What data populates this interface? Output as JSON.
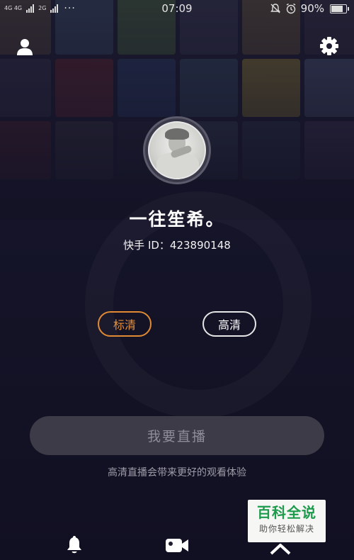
{
  "status_bar": {
    "network_primary": "4G 4G",
    "network_secondary": "2G",
    "more": "···",
    "time": "07:09",
    "battery_percent": "90%",
    "battery_level": 0.9
  },
  "header": {
    "profile_icon": "user-icon",
    "settings_icon": "gear-icon"
  },
  "profile": {
    "name": "一往笙希。",
    "id_text": "快手 ID：423890148"
  },
  "quality": {
    "options": [
      "标清",
      "高清"
    ],
    "selected": "标清"
  },
  "live": {
    "button_label": "我要直播",
    "hint": "高清直播会带来更好的观看体验"
  },
  "bottom_nav": [
    "bell-icon",
    "video-camera-icon",
    "chevron-up-icon"
  ],
  "watermark": {
    "title": "百科全说",
    "subtitle": "助你轻松解决"
  },
  "colors": {
    "accent": "#e8913a",
    "button_bg": "#3c3b47",
    "watermark_green": "#1c9b4d"
  }
}
